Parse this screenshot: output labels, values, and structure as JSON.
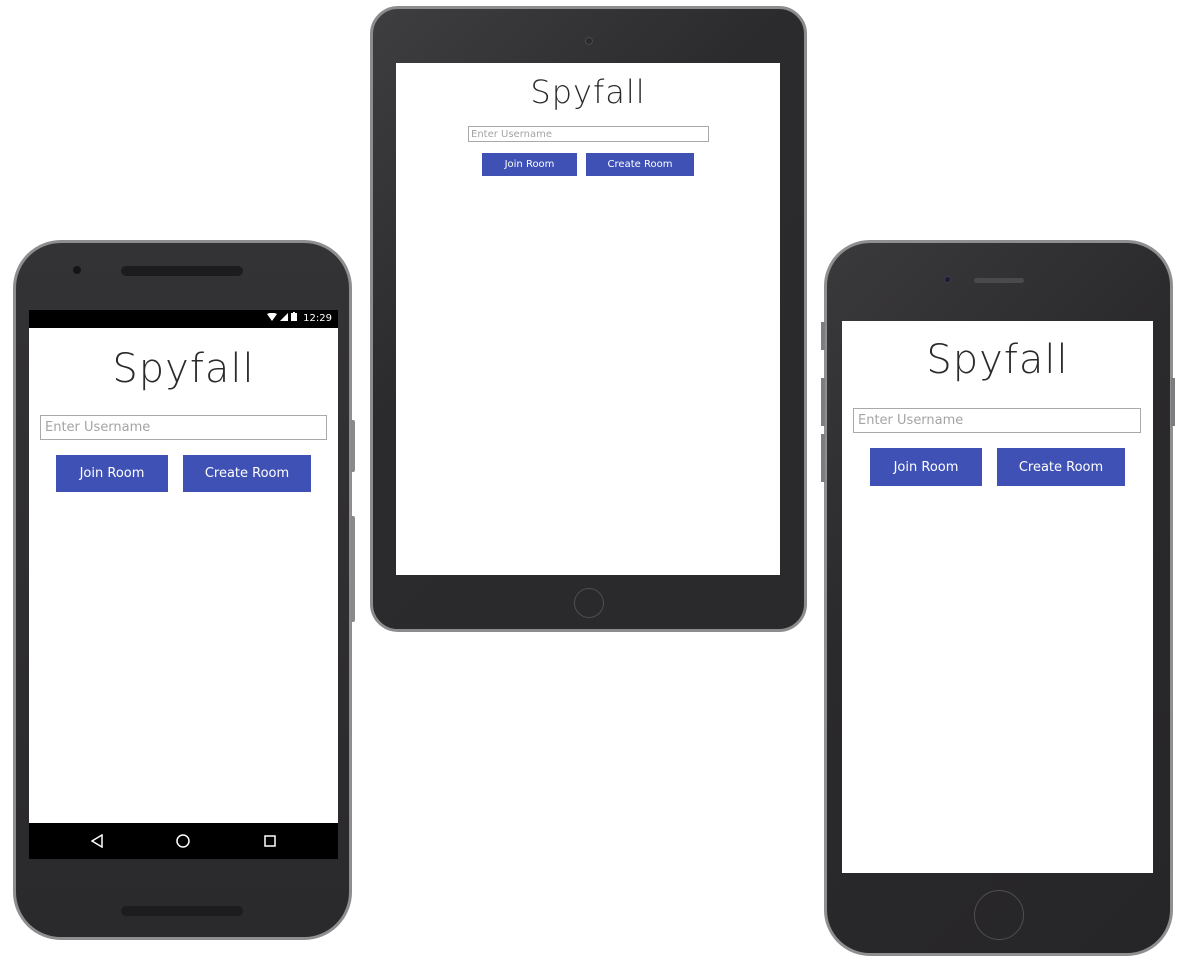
{
  "app": {
    "title": "Spyfall",
    "username_placeholder": "Enter Username",
    "join_label": "Join Room",
    "create_label": "Create Room"
  },
  "android": {
    "status_time": "12:29"
  },
  "colors": {
    "accent": "#3f51b5",
    "device_body": "#2b2a2c",
    "device_bezel": "#8e8d8f",
    "screen_bg": "#ffffff"
  },
  "icons": {
    "wifi": "wifi-icon",
    "signal": "signal-icon",
    "battery": "battery-icon",
    "back": "back-icon",
    "home": "home-icon",
    "recents": "recents-icon"
  }
}
